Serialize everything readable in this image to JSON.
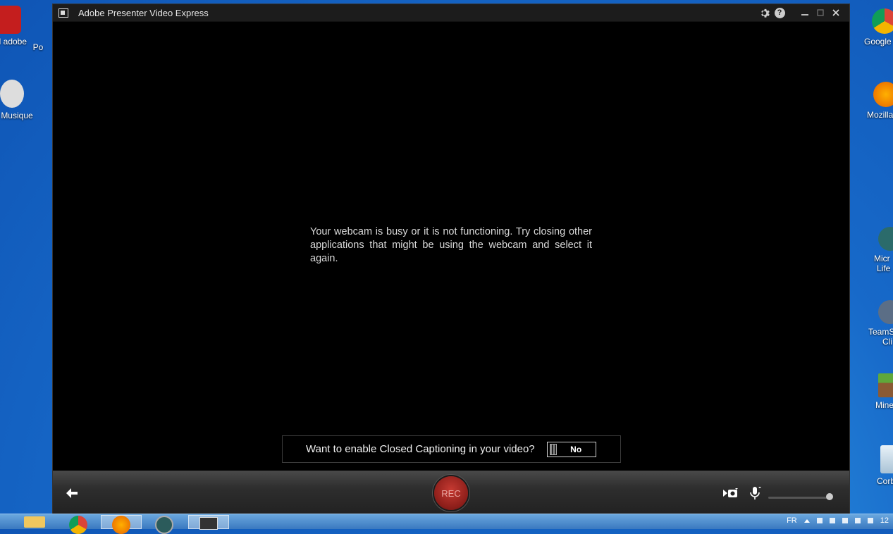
{
  "window": {
    "title": "Adobe Presenter Video Express",
    "message": "Your webcam is busy or it is not functioning. Try closing other applications that might be using the webcam and select it again.",
    "closed_caption": {
      "question": "Want to enable Closed Captioning in your video?",
      "state": "No"
    },
    "record_label": "REC"
  },
  "desktop_left": [
    {
      "label": "el adobe",
      "icon": "pdf-icon"
    },
    {
      "label": "Po",
      "icon": "app-icon"
    },
    {
      "label": "l Musique",
      "icon": "music-icon"
    }
  ],
  "desktop_right": [
    {
      "label": "Google",
      "icon": "chrome-icon"
    },
    {
      "label": "Mozilla",
      "icon": "firefox-icon"
    },
    {
      "label": "Micr",
      "label2": "Life",
      "icon": "lifecam-icon"
    },
    {
      "label": "TeamS",
      "label2": "Cli",
      "icon": "teamspeak-icon"
    },
    {
      "label": "Mine",
      "icon": "minecraft-icon"
    },
    {
      "label": "Corb",
      "icon": "recycle-bin-icon"
    }
  ],
  "taskbar": {
    "language": "FR",
    "clock": "12"
  },
  "colors": {
    "rec": "#a8241f",
    "desktop": "#1769c9"
  }
}
